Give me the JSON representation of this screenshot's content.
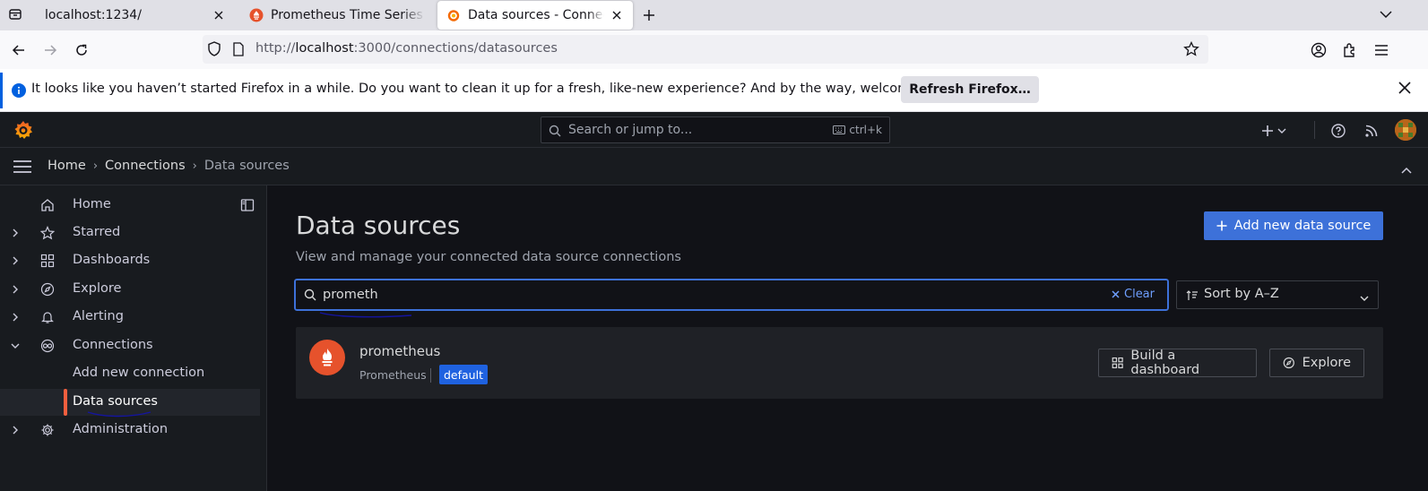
{
  "browser": {
    "tabs": [
      {
        "title": "localhost:1234/"
      },
      {
        "title": "Prometheus Time Series"
      },
      {
        "title": "Data sources - Connections"
      }
    ],
    "url_prefix": "http://",
    "url_host": "localhost",
    "url_rest": ":3000/connections/datasources",
    "notification": {
      "message": "It looks like you haven’t started Firefox in a while. Do you want to clean it up for a fresh, like-new experience? And by the way, welcome back!",
      "button_label": "Refresh Firefox…"
    }
  },
  "grafana": {
    "search_placeholder": "Search or jump to...",
    "search_shortcut": "ctrl+k",
    "breadcrumbs": [
      "Home",
      "Connections",
      "Data sources"
    ],
    "sidebar": {
      "items": [
        {
          "label": "Home",
          "icon": "home-icon"
        },
        {
          "label": "Starred",
          "icon": "star-icon"
        },
        {
          "label": "Dashboards",
          "icon": "apps-icon"
        },
        {
          "label": "Explore",
          "icon": "compass-icon"
        },
        {
          "label": "Alerting",
          "icon": "bell-icon"
        },
        {
          "label": "Connections",
          "icon": "link-icon"
        },
        {
          "label": "Add new connection"
        },
        {
          "label": "Data sources"
        },
        {
          "label": "Administration",
          "icon": "cog-icon"
        }
      ]
    },
    "page": {
      "title": "Data sources",
      "subtitle": "View and manage your connected data source connections",
      "add_button": "Add new data source",
      "filter_value": "prometh",
      "clear_label": "Clear",
      "sort_label": "Sort by A–Z"
    },
    "datasource": {
      "name": "prometheus",
      "type": "Prometheus",
      "badge": "default",
      "build_button": "Build a dashboard",
      "explore_button": "Explore"
    },
    "colors": {
      "accent": "#3d71d9",
      "prometheus": "#e6522c",
      "active_bar": "#f55f3e"
    }
  }
}
